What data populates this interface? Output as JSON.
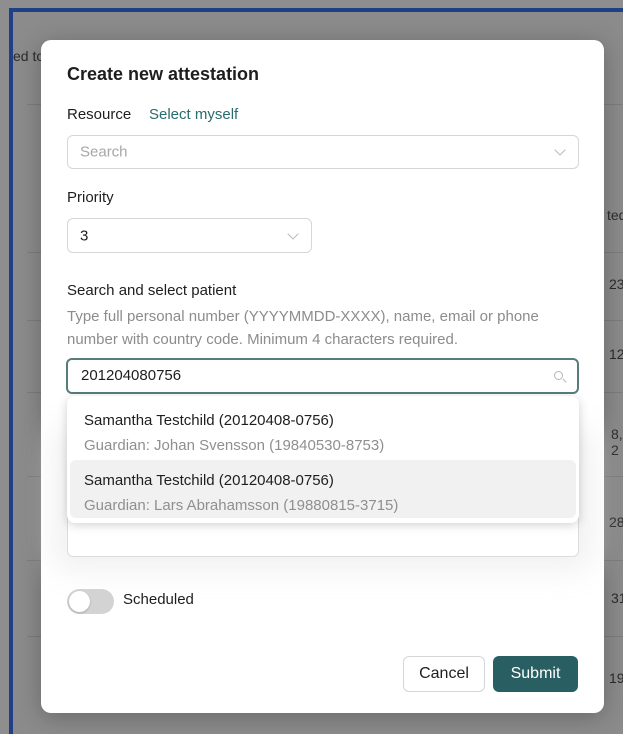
{
  "background": {
    "fragments": [
      "ed to",
      "ted",
      "23,",
      "12,",
      "8, 2",
      "28,",
      "31,",
      "19,"
    ]
  },
  "modal": {
    "title": "Create new attestation",
    "resource": {
      "label": "Resource",
      "select_myself": "Select myself",
      "placeholder": "Search"
    },
    "priority": {
      "label": "Priority",
      "value": "3"
    },
    "patient": {
      "label": "Search and select patient",
      "help": "Type full personal number (YYYYMMDD-XXXX), name, email or phone number with country code. Minimum 4 characters required.",
      "search_value": "201204080756",
      "results": [
        {
          "name": "Samantha Testchild (20120408-0756)",
          "guardian": "Guardian: Johan Svensson (19840530-8753)"
        },
        {
          "name": "Samantha Testchild (20120408-0756)",
          "guardian": "Guardian: Lars Abrahamsson (19880815-3715)"
        }
      ]
    },
    "scheduled": {
      "label": "Scheduled",
      "enabled": false
    },
    "buttons": {
      "cancel": "Cancel",
      "submit": "Submit"
    }
  },
  "colors": {
    "accent": "#295f63",
    "link": "#2a6b6e",
    "frame_border": "#1f3f86"
  }
}
